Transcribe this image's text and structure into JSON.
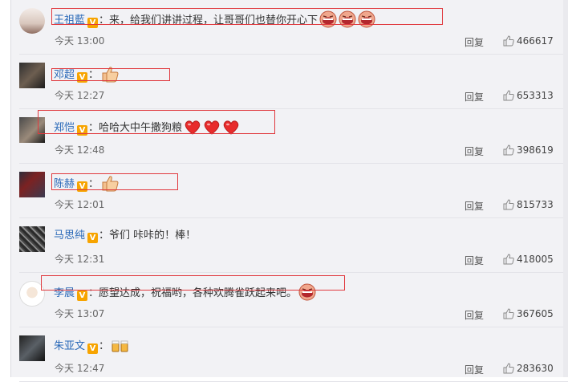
{
  "reply_label": "回复",
  "colon": "：",
  "comments": [
    {
      "user": "王祖藍",
      "text": "来，给我们讲讲过程，让哥哥们也替你开心下",
      "emoji": [
        "laughing-face-icon",
        "laughing-face-icon",
        "laughing-face-icon"
      ],
      "time": "今天 13:00",
      "likes": "466617"
    },
    {
      "user": "邓超",
      "text": "",
      "emoji": [
        "thumbs-up-icon"
      ],
      "time": "今天 12:27",
      "likes": "653313"
    },
    {
      "user": "郑恺",
      "text": "哈哈大中午撒狗粮",
      "emoji": [
        "heart-icon",
        "heart-icon",
        "heart-icon"
      ],
      "time": "今天 12:48",
      "likes": "398619"
    },
    {
      "user": "陈赫",
      "text": "",
      "emoji": [
        "thumbs-up-icon"
      ],
      "time": "今天 12:01",
      "likes": "815733"
    },
    {
      "user": "马思纯",
      "text": "爷们 咔咔的！棒！",
      "emoji": [],
      "time": "今天 12:31",
      "likes": "418005"
    },
    {
      "user": "李晨",
      "text": "愿望达成，祝福哟，各种欢腾雀跃起来吧。",
      "emoji": [
        "laughing-face-icon"
      ],
      "time": "今天 13:07",
      "likes": "367605"
    },
    {
      "user": "朱亚文",
      "text": "",
      "emoji": [
        "cheers-icon"
      ],
      "time": "今天 12:47",
      "likes": "283630"
    }
  ],
  "colors": {
    "username": "#2a69b8",
    "highlight_box": "#e0393e",
    "verified_badge": "#f7a400"
  }
}
